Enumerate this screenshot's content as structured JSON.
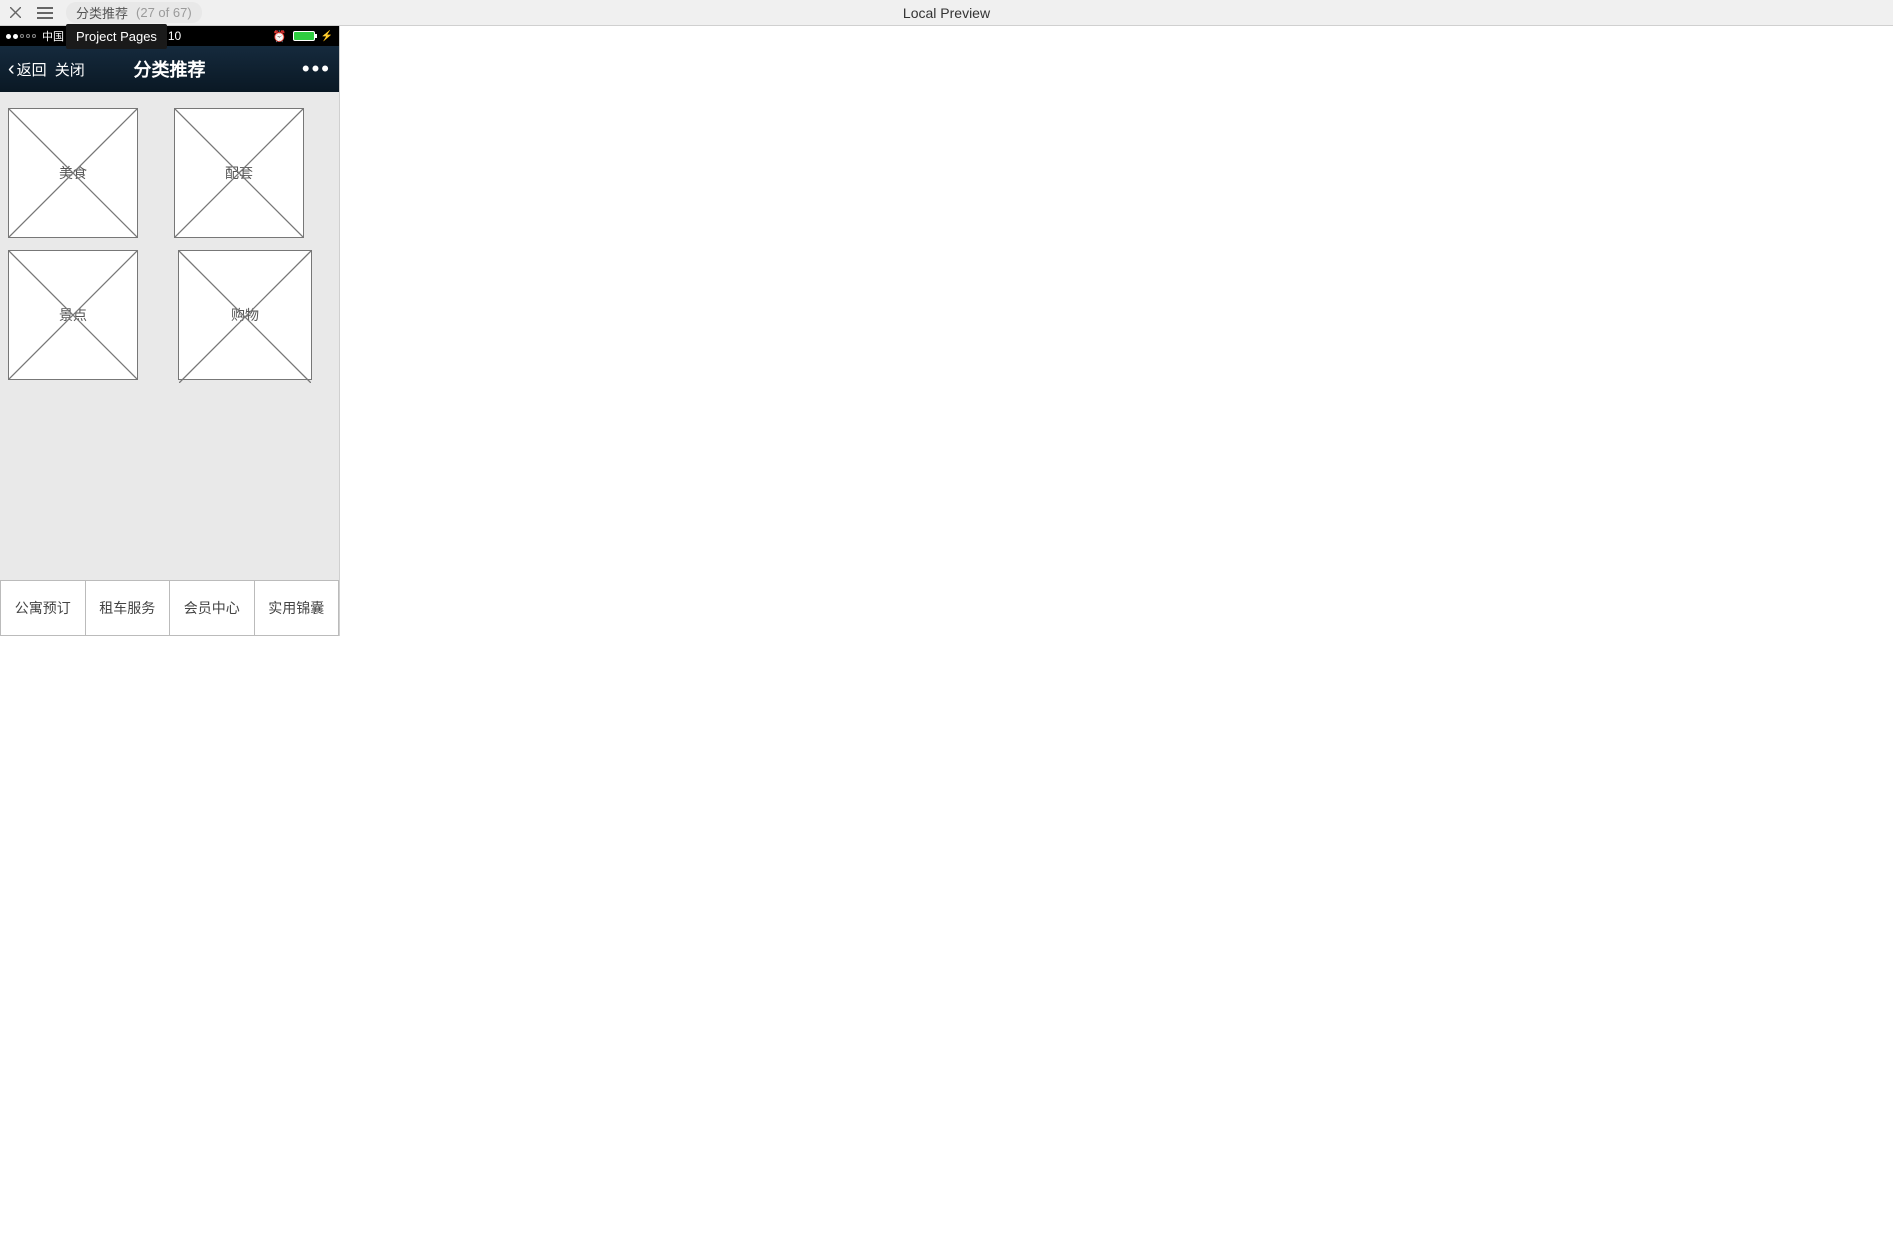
{
  "toolbar": {
    "page_name": "分类推荐",
    "page_count": "(27 of 67)",
    "preview_label": "Local Preview"
  },
  "tooltip": "Project Pages",
  "statusbar": {
    "carrier": "中国",
    "time": "8:10"
  },
  "navbar": {
    "back_label": "返回",
    "close_label": "关闭",
    "title": "分类推荐",
    "more": "•••"
  },
  "categories": [
    {
      "label": "美食"
    },
    {
      "label": "配套"
    },
    {
      "label": "景点"
    },
    {
      "label": "购物"
    }
  ],
  "bottom_tabs": [
    {
      "label": "公寓预订"
    },
    {
      "label": "租车服务"
    },
    {
      "label": "会员中心"
    },
    {
      "label": "实用锦囊"
    }
  ]
}
